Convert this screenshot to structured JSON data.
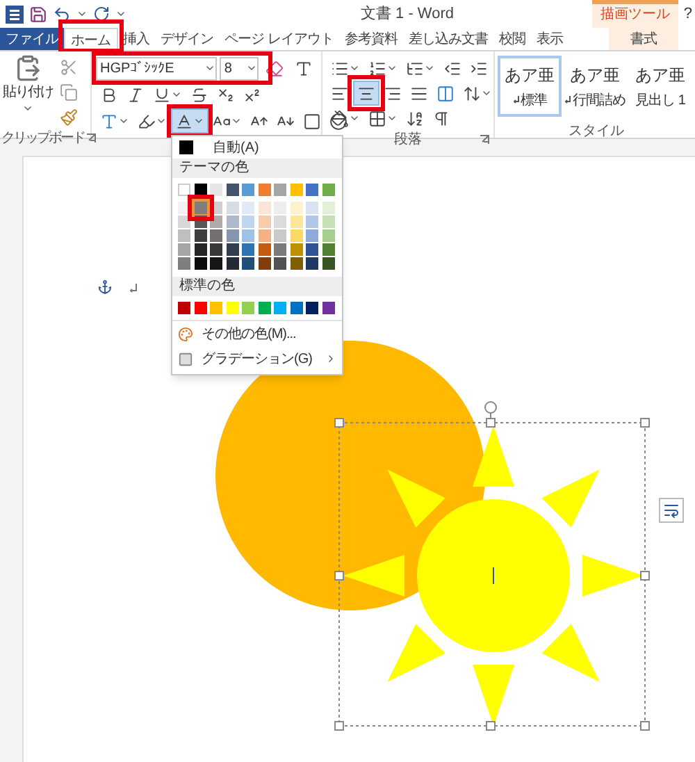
{
  "title_bar": {
    "title": "文書 1 - Word",
    "contextual_label": "描画ツール",
    "help": "?"
  },
  "tabs": [
    {
      "label": "ファイル",
      "kind": "file",
      "selected": false
    },
    {
      "label": "ホーム",
      "kind": "normal",
      "selected": true
    },
    {
      "label": "挿入",
      "kind": "normal",
      "selected": false
    },
    {
      "label": "デザイン",
      "kind": "normal",
      "selected": false
    },
    {
      "label": "ページ レイアウト",
      "kind": "normal",
      "selected": false
    },
    {
      "label": "参考資料",
      "kind": "normal",
      "selected": false
    },
    {
      "label": "差し込み文書",
      "kind": "normal",
      "selected": false
    },
    {
      "label": "校閲",
      "kind": "normal",
      "selected": false
    },
    {
      "label": "表示",
      "kind": "normal",
      "selected": false
    },
    {
      "label": "書式",
      "kind": "contextual",
      "selected": false
    }
  ],
  "clipboard": {
    "paste_label": "貼り付け",
    "group_label": "クリップボード"
  },
  "font": {
    "name": "HGPｺﾞｼｯｸE",
    "size": "8",
    "font_color_open": true
  },
  "paragraph": {
    "group_label": "段落",
    "align_buttons": [
      {
        "selected": false
      },
      {
        "selected": true
      },
      {
        "selected": false
      },
      {
        "selected": false
      }
    ]
  },
  "styles": {
    "group_label": "スタイル",
    "items": [
      {
        "sample": "あア亜",
        "name": "標準",
        "para_mark": true,
        "selected": true
      },
      {
        "sample": "あア亜",
        "name": "行間詰め",
        "para_mark": true,
        "selected": false
      },
      {
        "sample": "あア亜",
        "name": "見出し 1",
        "para_mark": false,
        "selected": false
      }
    ]
  },
  "color_menu": {
    "automatic": "自動(A)",
    "theme_heading": "テーマの色",
    "theme_colors": [
      [
        {
          "color": "#ffffff",
          "selected": false
        },
        {
          "color": "#000000",
          "selected": false
        },
        {
          "color": "#e7e6e6",
          "selected": false
        },
        {
          "color": "#44546a",
          "selected": false
        },
        {
          "color": "#5b9bd5",
          "selected": false
        },
        {
          "color": "#ed7d31",
          "selected": false
        },
        {
          "color": "#a5a5a5",
          "selected": false
        },
        {
          "color": "#ffc000",
          "selected": false
        },
        {
          "color": "#4472c4",
          "selected": false
        },
        {
          "color": "#70ad47",
          "selected": false
        }
      ],
      [
        {
          "color": "#f2f2f2",
          "selected": false
        },
        {
          "color": "#7f7f7f",
          "selected": true
        },
        {
          "color": "#d0cece",
          "selected": false
        },
        {
          "color": "#d6dce4",
          "selected": false
        },
        {
          "color": "#deebf6",
          "selected": false
        },
        {
          "color": "#fbe5d5",
          "selected": false
        },
        {
          "color": "#ededed",
          "selected": false
        },
        {
          "color": "#fff2cc",
          "selected": false
        },
        {
          "color": "#d9e2f3",
          "selected": false
        },
        {
          "color": "#e2efd9",
          "selected": false
        }
      ],
      [
        {
          "color": "#d8d8d8",
          "selected": false
        },
        {
          "color": "#595959",
          "selected": false
        },
        {
          "color": "#aeabab",
          "selected": false
        },
        {
          "color": "#adb9ca",
          "selected": false
        },
        {
          "color": "#bdd7ee",
          "selected": false
        },
        {
          "color": "#f7cbac",
          "selected": false
        },
        {
          "color": "#dbdbdb",
          "selected": false
        },
        {
          "color": "#fee599",
          "selected": false
        },
        {
          "color": "#b4c6e7",
          "selected": false
        },
        {
          "color": "#c5e0b3",
          "selected": false
        }
      ],
      [
        {
          "color": "#bfbfbf",
          "selected": false
        },
        {
          "color": "#3f3f3f",
          "selected": false
        },
        {
          "color": "#757070",
          "selected": false
        },
        {
          "color": "#8496b0",
          "selected": false
        },
        {
          "color": "#9cc3e5",
          "selected": false
        },
        {
          "color": "#f4b183",
          "selected": false
        },
        {
          "color": "#c9c9c9",
          "selected": false
        },
        {
          "color": "#ffd965",
          "selected": false
        },
        {
          "color": "#8eaadb",
          "selected": false
        },
        {
          "color": "#a8d08d",
          "selected": false
        }
      ],
      [
        {
          "color": "#a5a5a5",
          "selected": false
        },
        {
          "color": "#262626",
          "selected": false
        },
        {
          "color": "#3a3838",
          "selected": false
        },
        {
          "color": "#323f4f",
          "selected": false
        },
        {
          "color": "#2e75b5",
          "selected": false
        },
        {
          "color": "#c55a11",
          "selected": false
        },
        {
          "color": "#7b7b7b",
          "selected": false
        },
        {
          "color": "#bf9000",
          "selected": false
        },
        {
          "color": "#2f5496",
          "selected": false
        },
        {
          "color": "#538135",
          "selected": false
        }
      ],
      [
        {
          "color": "#7f7f7f",
          "selected": false
        },
        {
          "color": "#0c0c0c",
          "selected": false
        },
        {
          "color": "#171616",
          "selected": false
        },
        {
          "color": "#222a35",
          "selected": false
        },
        {
          "color": "#1e4e79",
          "selected": false
        },
        {
          "color": "#833c0b",
          "selected": false
        },
        {
          "color": "#525252",
          "selected": false
        },
        {
          "color": "#7f6000",
          "selected": false
        },
        {
          "color": "#1f3864",
          "selected": false
        },
        {
          "color": "#375623",
          "selected": false
        }
      ]
    ],
    "standard_heading": "標準の色",
    "standard_colors": [
      {
        "color": "#c00000",
        "selected": false
      },
      {
        "color": "#ff0000",
        "selected": false
      },
      {
        "color": "#ffc000",
        "selected": false
      },
      {
        "color": "#ffff00",
        "selected": false
      },
      {
        "color": "#92d050",
        "selected": false
      },
      {
        "color": "#00b050",
        "selected": false
      },
      {
        "color": "#00b0f0",
        "selected": false
      },
      {
        "color": "#0070c0",
        "selected": false
      },
      {
        "color": "#002060",
        "selected": false
      },
      {
        "color": "#7030a0",
        "selected": false
      }
    ],
    "more_colors": "その他の色(M)...",
    "gradient": "グラデーション(G)"
  }
}
